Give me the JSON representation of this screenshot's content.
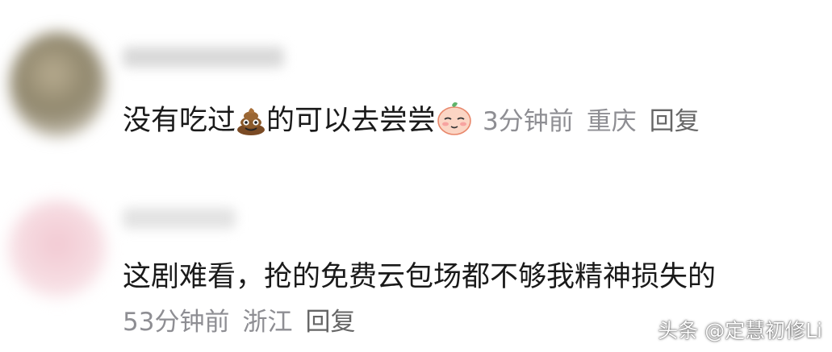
{
  "comments": [
    {
      "text_before_emoji": "没有吃过",
      "emoji_1": "poop-emoji",
      "text_after_emoji": "的可以去尝尝",
      "emoji_2": "sticker-emoji",
      "time": "3分钟前",
      "location": "重庆",
      "reply_label": "回复"
    },
    {
      "text": "这剧难看，抢的免费云包场都不够我精神损失的",
      "time": "53分钟前",
      "location": "浙江",
      "reply_label": "回复"
    }
  ],
  "watermark": "头条 @定慧初修Li"
}
